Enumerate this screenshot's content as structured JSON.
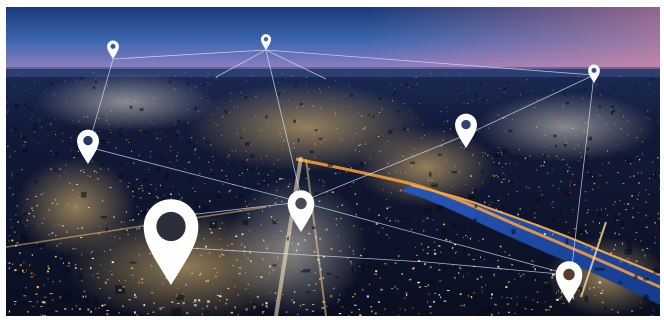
{
  "scene": {
    "subject": "night-city-aerial-with-map-pins",
    "colors": {
      "sky_top": "#1a3d7a",
      "sky_mid": "#3a5fa8",
      "sky_horizon": "#e07fa6",
      "city_dark": "#0b1226",
      "light_warm": "#ffc766",
      "light_white": "#fff4d9",
      "river": "#1d4aa0",
      "pin": "#ffffff"
    }
  },
  "pins": [
    {
      "id": "pin-far-left",
      "size": "small"
    },
    {
      "id": "pin-horizon-center",
      "size": "small"
    },
    {
      "id": "pin-far-right",
      "size": "small"
    },
    {
      "id": "pin-mid-left",
      "size": "medium"
    },
    {
      "id": "pin-mid-right",
      "size": "medium"
    },
    {
      "id": "pin-center",
      "size": "medium"
    },
    {
      "id": "pin-large-foreground",
      "size": "large"
    },
    {
      "id": "pin-bottom-right",
      "size": "medium"
    }
  ]
}
